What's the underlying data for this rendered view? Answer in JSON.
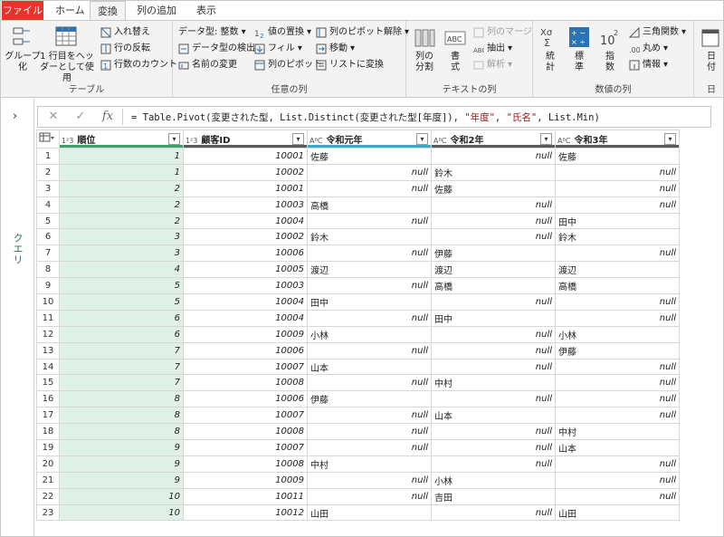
{
  "tabs": [
    "ファイル",
    "ホーム",
    "変換",
    "列の追加",
    "表示"
  ],
  "ribbon": {
    "table_group": {
      "label": "テーブル",
      "group_by": "グループ化",
      "use_first_row_line1": "1 行目をヘッ",
      "use_first_row_line2": "ダーとして使用",
      "transpose": "入れ替え",
      "reverse_rows": "行の反転",
      "count_rows": "行数のカウント"
    },
    "any_column_group": {
      "label": "任意の列",
      "data_type": "データ型: 整数",
      "detect_type": "データ型の検出",
      "rename": "名前の変更",
      "replace_values": "値の置換",
      "fill": "フィル",
      "pivot": "列のピボット",
      "unpivot": "列のピボット解除",
      "move": "移動",
      "to_list": "リストに変換"
    },
    "text_column_group": {
      "label": "テキストの列",
      "split_line1": "列の",
      "split_line2": "分割",
      "format_line1": "書",
      "format_line2": "式",
      "merge": "列のマージ",
      "extract": "抽出",
      "parse": "解析"
    },
    "number_column_group": {
      "label": "数値の列",
      "stats_line1": "統",
      "stats_line2": "計",
      "standard_line1": "標",
      "standard_line2": "準",
      "scientific_line1": "指",
      "scientific_line2": "数",
      "trig": "三角関数",
      "rounding": "丸め",
      "info": "情報"
    },
    "date_group": {
      "label": "日",
      "date_line1": "日",
      "date_line2": "付"
    }
  },
  "side": {
    "queries_label": "クエリ"
  },
  "formula": {
    "prefix": "= Table.Pivot(変更された型, List.Distinct(変更された型[年度]), ",
    "arg1": "\"年度\"",
    "sep": ", ",
    "arg2": "\"氏名\"",
    "suffix": ", List.Min)"
  },
  "columns": [
    {
      "type": "1²3",
      "name": "順位",
      "color": "#3c9f6a"
    },
    {
      "type": "1²3",
      "name": "顧客ID",
      "color": "#5a5a5a"
    },
    {
      "type": "AᴮC",
      "name": "令和元年",
      "color": "#3aa9c8"
    },
    {
      "type": "AᴮC",
      "name": "令和2年",
      "color": "#5a5a5a"
    },
    {
      "type": "AᴮC",
      "name": "令和3年",
      "color": "#5a5a5a"
    }
  ],
  "rows": [
    [
      "1",
      "1",
      "10001",
      "佐藤",
      "null",
      "佐藤"
    ],
    [
      "2",
      "1",
      "10002",
      "null",
      "鈴木",
      "null"
    ],
    [
      "3",
      "2",
      "10001",
      "null",
      "佐藤",
      "null"
    ],
    [
      "4",
      "2",
      "10003",
      "高橋",
      "null",
      "null"
    ],
    [
      "5",
      "2",
      "10004",
      "null",
      "null",
      "田中"
    ],
    [
      "6",
      "3",
      "10002",
      "鈴木",
      "null",
      "鈴木"
    ],
    [
      "7",
      "3",
      "10006",
      "null",
      "伊藤",
      "null"
    ],
    [
      "8",
      "4",
      "10005",
      "渡辺",
      "渡辺",
      "渡辺"
    ],
    [
      "9",
      "5",
      "10003",
      "null",
      "高橋",
      "高橋"
    ],
    [
      "10",
      "5",
      "10004",
      "田中",
      "null",
      "null"
    ],
    [
      "11",
      "6",
      "10004",
      "null",
      "田中",
      "null"
    ],
    [
      "12",
      "6",
      "10009",
      "小林",
      "null",
      "小林"
    ],
    [
      "13",
      "7",
      "10006",
      "null",
      "null",
      "伊藤"
    ],
    [
      "14",
      "7",
      "10007",
      "山本",
      "null",
      "null"
    ],
    [
      "15",
      "7",
      "10008",
      "null",
      "中村",
      "null"
    ],
    [
      "16",
      "8",
      "10006",
      "伊藤",
      "null",
      "null"
    ],
    [
      "17",
      "8",
      "10007",
      "null",
      "山本",
      "null"
    ],
    [
      "18",
      "8",
      "10008",
      "null",
      "null",
      "中村"
    ],
    [
      "19",
      "9",
      "10007",
      "null",
      "null",
      "山本"
    ],
    [
      "20",
      "9",
      "10008",
      "中村",
      "null",
      "null"
    ],
    [
      "21",
      "9",
      "10009",
      "null",
      "小林",
      "null"
    ],
    [
      "22",
      "10",
      "10011",
      "null",
      "吉田",
      "null"
    ],
    [
      "23",
      "10",
      "10012",
      "山田",
      "null",
      "山田"
    ]
  ]
}
